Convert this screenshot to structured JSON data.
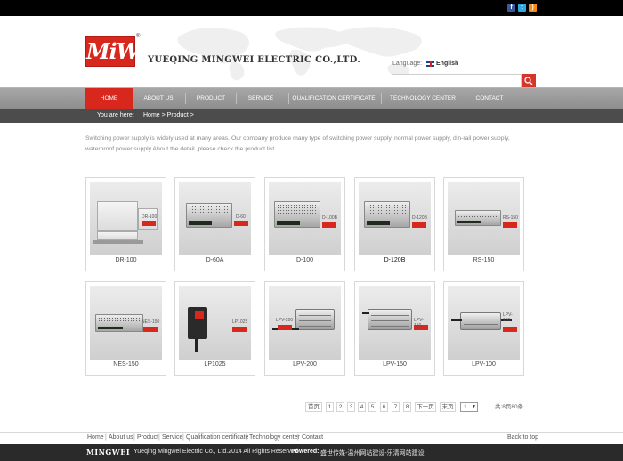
{
  "social": [
    {
      "name": "facebook",
      "glyph": "f"
    },
    {
      "name": "twitter",
      "glyph": "t"
    },
    {
      "name": "rss",
      "glyph": ")"
    }
  ],
  "header": {
    "logo_text": "MiWi",
    "registered": "®",
    "company": "YUEQING MINGWEI ELECTRIC CO.,LTD.",
    "language_label": "Language:",
    "language_value": "English",
    "search_placeholder": ""
  },
  "nav": {
    "items": [
      {
        "label": "HOME",
        "active": true
      },
      {
        "label": "ABOUT US",
        "active": false
      },
      {
        "label": "PRODUCT",
        "active": false
      },
      {
        "label": "SERVICE",
        "active": false
      },
      {
        "label": "QUALIFICATION CERTIFICATE",
        "active": false
      },
      {
        "label": "TECHNOLOGY CENTER",
        "active": false
      },
      {
        "label": "CONTACT",
        "active": false
      }
    ]
  },
  "breadcrumb": {
    "label": "You are here:",
    "value": "Home > Product >"
  },
  "intro": "Switching power supply is widely used at many areas. Our company produce many type of switching power supply, normal power supply, din-rail power supply, waterproof power supply.About the detail ,please check the product list.",
  "products": [
    {
      "name": "DR-100",
      "label": "DR-100"
    },
    {
      "name": "D-60A",
      "label": "D-60"
    },
    {
      "name": "D-100",
      "label": "D-100B"
    },
    {
      "name": "D-120B",
      "label": "D-120B"
    },
    {
      "name": "RS-150",
      "label": "RS-150"
    },
    {
      "name": "NES-150",
      "label": "NES-150"
    },
    {
      "name": "LP1025",
      "label": "LP1025"
    },
    {
      "name": "LPV-200",
      "label": "LPV-200"
    },
    {
      "name": "LPV-150",
      "label": "LPV-150"
    },
    {
      "name": "LPV-100",
      "label": "LPV-100"
    }
  ],
  "pagination": {
    "first": "首页",
    "pages": [
      "1",
      "2",
      "3",
      "4",
      "5",
      "6",
      "7",
      "8"
    ],
    "next": "下一页",
    "last": "末页",
    "selected": "1",
    "summary": "共:8页80条"
  },
  "footer": {
    "links": [
      "Home",
      "About us",
      "Product",
      "Service",
      "Qualification certificate",
      "Technology center",
      "Contact"
    ],
    "separator": "|",
    "back_to_top": "Back to top",
    "logo": "MINGWEI",
    "copyright": "Yueqing Mingwei Electric Co., Ltd.2014 All Rights Reserved",
    "powered_label": "Powered:",
    "powered_value": "盛世传媒-温州网站建设-乐清网站建设"
  },
  "colors": {
    "accent": "#d8281e",
    "nav": "#9b9b9b",
    "breadcrumb_bar": "#4c4c4c",
    "topbar": "#000000"
  }
}
